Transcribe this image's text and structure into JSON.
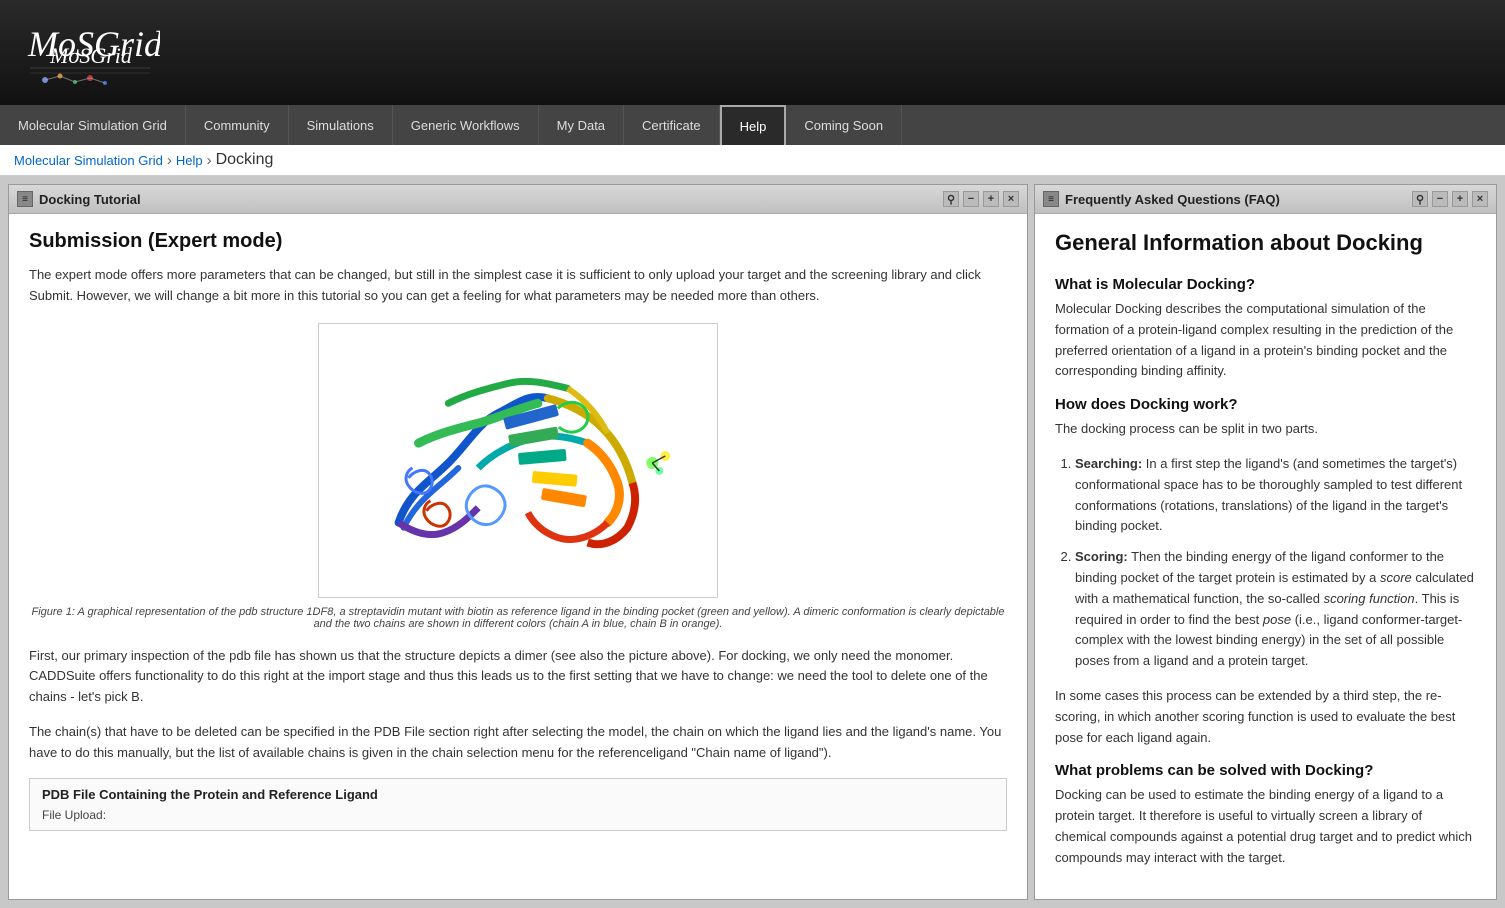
{
  "header": {
    "logo_alt": "MoSGrid logo"
  },
  "nav": {
    "items": [
      {
        "label": "Molecular Simulation Grid",
        "active": false
      },
      {
        "label": "Community",
        "active": false
      },
      {
        "label": "Simulations",
        "active": false
      },
      {
        "label": "Generic Workflows",
        "active": false
      },
      {
        "label": "My Data",
        "active": false
      },
      {
        "label": "Certificate",
        "active": false
      },
      {
        "label": "Help",
        "active": true
      },
      {
        "label": "Coming Soon",
        "active": false
      }
    ]
  },
  "breadcrumb": {
    "items": [
      {
        "label": "Molecular Simulation Grid",
        "link": true
      },
      {
        "label": "Help",
        "link": true
      },
      {
        "label": "Docking",
        "link": false
      }
    ]
  },
  "left_panel": {
    "title": "Docking Tutorial",
    "controls": [
      "pin",
      "minimize",
      "maximize",
      "close"
    ],
    "content": {
      "section_title": "Submission (Expert mode)",
      "intro_text": "The expert mode offers more parameters that can be changed, but still in the simplest case it is sufficient to only upload your target and the screening library and click Submit. However, we will change a bit more in this tutorial so you can get a feeling for what parameters may be needed more than others.",
      "figure_caption": "Figure 1: A graphical representation of the pdb structure 1DF8, a streptavidin mutant with biotin as reference ligand in the binding pocket (green and yellow). A dimeric conformation is clearly depictable and the two chains are shown in different colors (chain A in blue, chain B in orange).",
      "body_text_1": "First, our primary inspection of the pdb file has shown us that the structure depicts a dimer (see also the picture above). For docking, we only need the monomer. CADDSuite offers functionality to do this right at the import stage and thus this leads us to the first setting that we have to change: we need the tool to delete one of the chains - let's pick B.",
      "body_text_2": "The chain(s) that have to be deleted can be specified in the PDB File section right after selecting the model, the chain on which the ligand lies and the ligand's name. You have to do this manually, but the list of available chains is given in the chain selection menu for the referenceligand \"Chain name of ligand\").",
      "pdb_section_title": "PDB File Containing the Protein and Reference Ligand",
      "file_upload_label": "File Upload:"
    }
  },
  "right_panel": {
    "title": "Frequently Asked Questions (FAQ)",
    "controls": [
      "pin",
      "minimize",
      "maximize",
      "close"
    ],
    "content": {
      "main_title": "General Information about Docking",
      "sections": [
        {
          "title": "What is Molecular Docking?",
          "text": "Molecular Docking describes the computational simulation of the formation of a protein-ligand complex resulting in the prediction of the preferred orientation of a ligand in a protein's binding pocket and the corresponding binding affinity."
        },
        {
          "title": "How does Docking work?",
          "intro": "The docking process can be split in two parts.",
          "list": [
            {
              "bold": "Searching:",
              "text": " In a first step the ligand's (and sometimes the target's) conformational space has to be thoroughly sampled to test different conformations (rotations, translations) of the ligand in the target's binding pocket."
            },
            {
              "bold": "Scoring:",
              "text": " Then the binding energy of the ligand conformer to the binding pocket of the target protein is estimated by a ",
              "italic1": "score",
              "text2": " calculated with a mathematical function, the so-called ",
              "italic2": "scoring function",
              "text3": ". This is required in order to find the best ",
              "italic3": "pose",
              "text4": " (i.e., ligand conformer-target-complex with the lowest binding energy) in the set of all possible poses from a ligand and a protein target."
            }
          ],
          "extra": "In some cases this process can be extended by a third step, the re-scoring, in which another scoring function is used to evaluate the best pose for each ligand again."
        },
        {
          "title": "What problems can be solved with Docking?",
          "text": "Docking can be used to estimate the binding energy of a ligand to a protein target. It therefore is useful to virtually screen a library of chemical compounds against a potential drug target and to predict which compounds may interact with the target."
        }
      ]
    }
  }
}
